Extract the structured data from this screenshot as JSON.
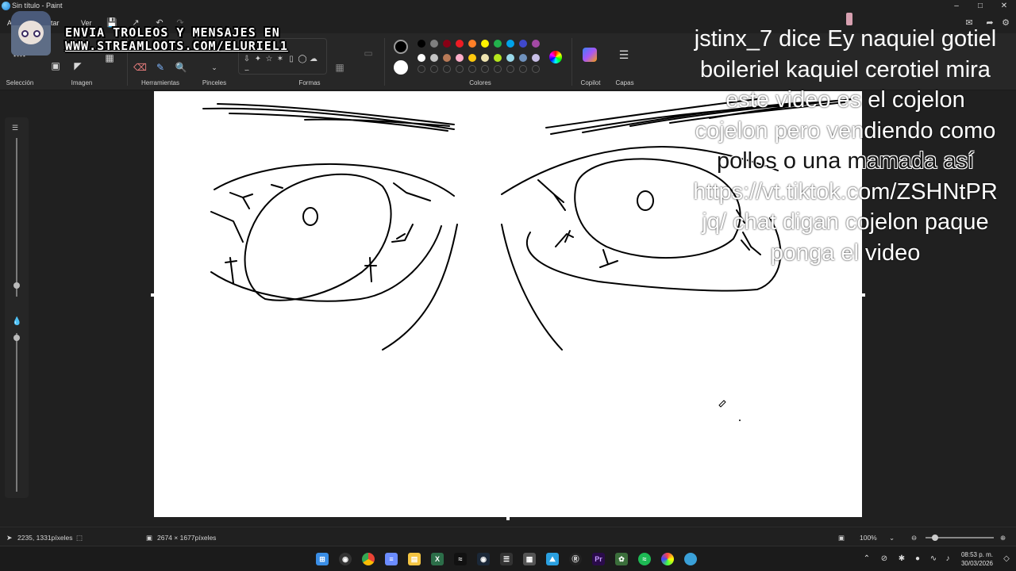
{
  "window": {
    "title": "Sin título - Paint"
  },
  "menu": {
    "file": "Ar",
    "edit": "itar",
    "view": "Ver"
  },
  "ribbon": {
    "groups": {
      "selection": "Selección",
      "image": "Imagen",
      "tools": "Herramientas",
      "brushes": "Pinceles",
      "shapes": "Formas",
      "colors": "Colores",
      "copilot": "Copilot",
      "layers": "Capas"
    },
    "palette_row1": [
      "#000000",
      "#7f7f7f",
      "#880015",
      "#ed1c24",
      "#ff7f27",
      "#fff200",
      "#22b14c",
      "#00a2e8",
      "#3f48cc",
      "#a349a4"
    ],
    "palette_row2": [
      "#ffffff",
      "#c3c3c3",
      "#b97a57",
      "#ffaec9",
      "#ffc90e",
      "#efe4b0",
      "#b5e61d",
      "#99d9ea",
      "#7092be",
      "#c8bfe7"
    ]
  },
  "banner": {
    "line1": "ENVIA TROLEOS Y MENSAJES EN",
    "line2": "WWW.STREAMLOOTS.COM/ELURIEL1"
  },
  "chat_overlay": {
    "lines": [
      "jstinx_7 dice Ey naquiel gotiel",
      "boileriel kaquiel cerotiel mira",
      "este video es el cojelon",
      "cojelon pero vendiendo como",
      "pollos o una mamada así",
      "https://vt.tiktok.com/ZSHNtPR",
      "jq/ chat digan cojelon paque",
      "ponga el video"
    ]
  },
  "statusbar": {
    "cursor_position": "2235, 1331píxeles",
    "canvas_size": "2674 × 1677píxeles",
    "zoom": "100%"
  },
  "taskbar": {
    "clock_time": "08:53 p. m.",
    "clock_date": "30/03/2026"
  }
}
